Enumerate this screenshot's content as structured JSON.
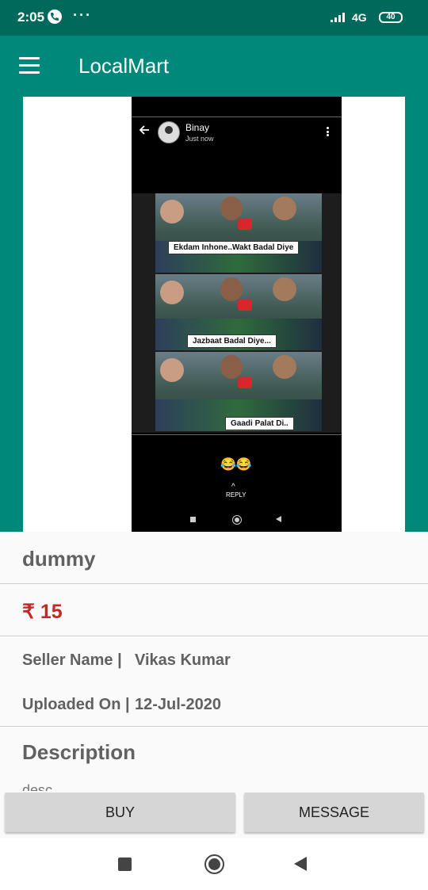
{
  "status_bar": {
    "time": "2:05",
    "dots": "···",
    "network": "4G",
    "battery": "40"
  },
  "app_bar": {
    "title": "LocalMart",
    "menu_icon": "hamburger-menu-icon"
  },
  "product_image": {
    "chat_name": "Binay",
    "chat_time": "Just now",
    "captions": [
      "Ekdam Inhone..Wakt Badal Diye",
      "Jazbaat Badal Diye...",
      "Gaadi Palat Di.."
    ],
    "emoji": "😂😂",
    "reply_label": "REPLY"
  },
  "product": {
    "name": "dummy",
    "price": "₹ 15",
    "seller_label": "Seller Name |",
    "seller_name": "Vikas Kumar",
    "uploaded_label": "Uploaded On |",
    "uploaded_date": "12-Jul-2020",
    "description_title": "Description",
    "description_text": "desc"
  },
  "actions": {
    "buy_label": "BUY",
    "message_label": "MESSAGE"
  },
  "colors": {
    "status_bar": "#00695c",
    "app_bar": "#00897b",
    "price": "#c62828"
  }
}
